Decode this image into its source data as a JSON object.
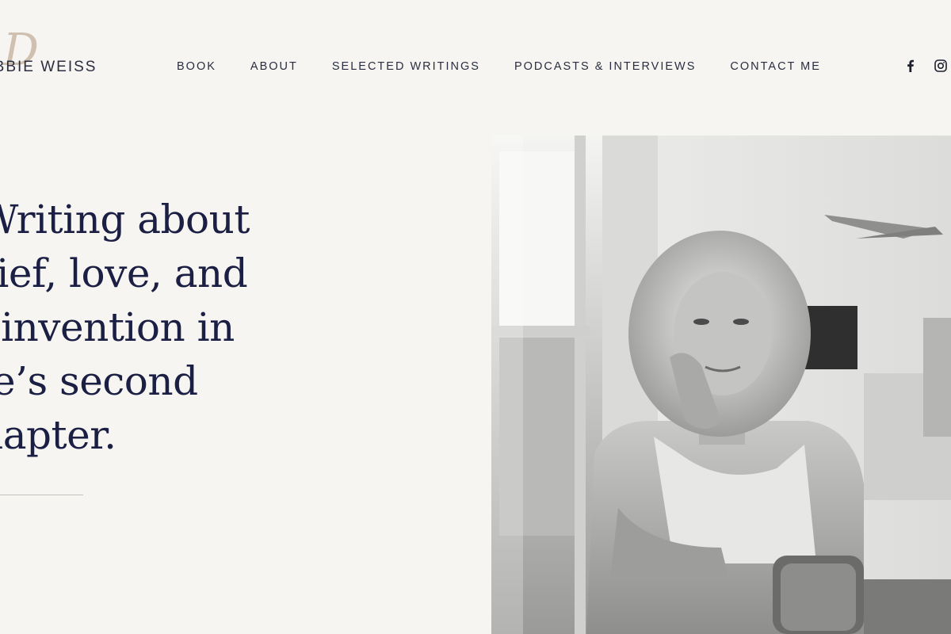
{
  "brand": {
    "wordmark": "EBBIE WEISS",
    "script_initial": "D"
  },
  "nav": {
    "items": [
      {
        "label": "BOOK"
      },
      {
        "label": "ABOUT"
      },
      {
        "label": "SELECTED WRITINGS"
      },
      {
        "label": "PODCASTS & INTERVIEWS"
      },
      {
        "label": "CONTACT ME"
      }
    ]
  },
  "social": {
    "icons": [
      "facebook-icon",
      "instagram-icon"
    ]
  },
  "hero": {
    "lines": [
      "Writing about",
      "rief, love, and",
      "einvention in",
      "fe’s second",
      "hapter."
    ]
  },
  "colors": {
    "background": "#f6f5f1",
    "heading": "#1c1f44",
    "nav_text": "#2a2d3f",
    "logo_script": "#c9b7a4"
  }
}
